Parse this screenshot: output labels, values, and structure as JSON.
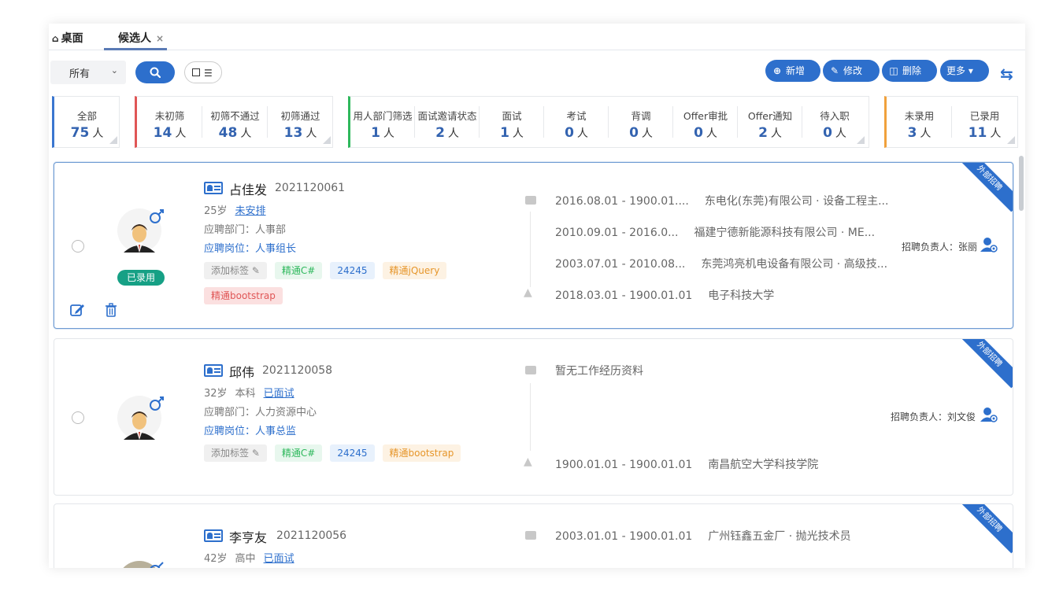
{
  "tabs": {
    "home_label": "桌面",
    "candidate_label": "候选人",
    "close": "×"
  },
  "toolbar": {
    "filter_select": "所有",
    "add": "新增",
    "edit": "修改",
    "delete": "删除",
    "more": "更多"
  },
  "stats": {
    "unit": "人",
    "all": {
      "label": "全部",
      "count": "75"
    },
    "screening": [
      {
        "label": "未初筛",
        "count": "14"
      },
      {
        "label": "初筛不通过",
        "count": "48"
      },
      {
        "label": "初筛通过",
        "count": "13"
      }
    ],
    "process": [
      {
        "label": "用人部门筛选",
        "count": "1"
      },
      {
        "label": "面试邀请状态",
        "count": "2"
      },
      {
        "label": "面试",
        "count": "1"
      },
      {
        "label": "考试",
        "count": "0"
      },
      {
        "label": "背调",
        "count": "0"
      },
      {
        "label": "Offer审批",
        "count": "0"
      },
      {
        "label": "Offer通知",
        "count": "2"
      },
      {
        "label": "待入职",
        "count": "0"
      }
    ],
    "result": [
      {
        "label": "未录用",
        "count": "3"
      },
      {
        "label": "已录用",
        "count": "11"
      }
    ]
  },
  "candidates": [
    {
      "name": "占佳发",
      "id": "2021120061",
      "age": "25岁",
      "status": "未安排",
      "dept": "应聘部门：人事部",
      "post": "应聘岗位：人事组长",
      "hired_badge": "已录用",
      "tags": [
        "添加标签",
        "精通C#",
        "24245",
        "精通jQuery",
        "精通bootstrap"
      ],
      "work": [
        {
          "period": "2016.08.01 - 1900.01....",
          "company": "东电化(东莞)有限公司 · 设备工程主..."
        },
        {
          "period": "2010.09.01 - 2016.0...",
          "company": "福建宁德新能源科技有限公司 · ME..."
        },
        {
          "period": "2003.07.01 - 2010.08...",
          "company": "东莞鸿亮机电设备有限公司 · 高级技..."
        }
      ],
      "school": {
        "period": "2018.03.01 - 1900.01.01",
        "name": "电子科技大学"
      },
      "recruiter": "招聘负责人：张丽",
      "ribbon": "外部招聘"
    },
    {
      "name": "邱伟",
      "id": "2021120058",
      "age": "32岁",
      "edu": "本科",
      "status": "已面试",
      "dept": "应聘部门：人力资源中心",
      "post": "应聘岗位：人事总监",
      "tags": [
        "添加标签",
        "精通C#",
        "24245",
        "精通bootstrap"
      ],
      "work_empty": "暂无工作经历资料",
      "school": {
        "period": "1900.01.01 - 1900.01.01",
        "name": "南昌航空大学科技学院"
      },
      "recruiter": "招聘负责人：刘文俊",
      "ribbon": "外部招聘"
    },
    {
      "name": "李亨友",
      "id": "2021120056",
      "age": "42岁",
      "edu": "高中",
      "status": "已面试",
      "work": [
        {
          "period": "2003.01.01 - 1900.01.01",
          "company": "广州钰鑫五金厂 · 抛光技术员"
        }
      ],
      "ribbon": "外部招聘"
    }
  ]
}
